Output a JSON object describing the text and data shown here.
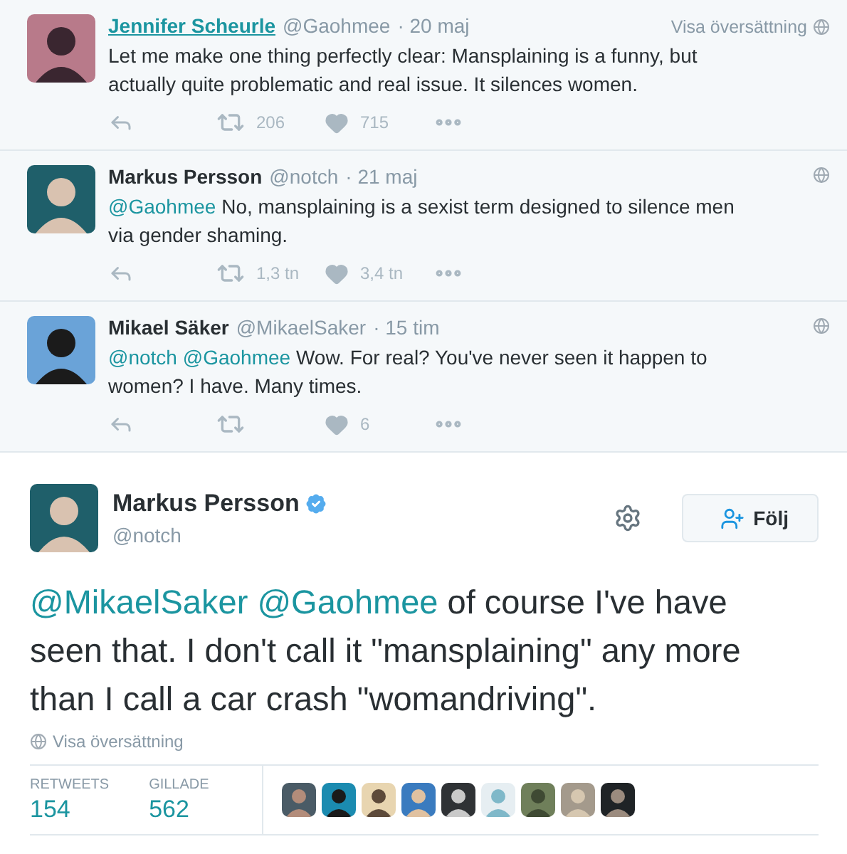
{
  "replies": [
    {
      "name": "Jennifer Scheurle",
      "name_link": true,
      "handle": "@Gaohmee",
      "time": "· 20 maj",
      "translate": "Visa översättning",
      "text": "Let me make one thing perfectly clear: Mansplaining is a funny, but actually quite problematic and real issue. It silences women.",
      "retweets": "206",
      "likes": "715"
    },
    {
      "name": "Markus Persson",
      "name_link": false,
      "handle": "@notch",
      "time": "· 21 maj",
      "mentions": [
        "@Gaohmee"
      ],
      "text": "No, mansplaining is a sexist term designed to silence men via gender shaming.",
      "retweets": "1,3 tn",
      "likes": "3,4 tn"
    },
    {
      "name": "Mikael Säker",
      "name_link": false,
      "handle": "@MikaelSaker",
      "time": "· 15 tim",
      "mentions": [
        "@notch",
        "@Gaohmee"
      ],
      "text": "Wow. For real? You've never seen it happen to women? I have. Many times.",
      "likes": "6"
    }
  ],
  "tweet": {
    "name": "Markus Persson",
    "verified": true,
    "handle": "@notch",
    "follow": "Följ",
    "mentions": [
      "@MikaelSaker",
      "@Gaohmee"
    ],
    "text": "of course I've have seen that. I don't call it \"mansplaining\" any more than I call a car crash \"womandriving\".",
    "translate": "Visa översättning",
    "stats": [
      {
        "label": "RETWEETS",
        "value": "154"
      },
      {
        "label": "GILLADE",
        "value": "562"
      }
    ],
    "likers": [
      {
        "kind": "avatar"
      },
      {
        "kind": "avatar"
      },
      {
        "kind": "avatar"
      },
      {
        "kind": "avatar"
      },
      {
        "kind": "avatar"
      },
      {
        "kind": "avatar"
      },
      {
        "kind": "avatar"
      },
      {
        "kind": "avatar"
      },
      {
        "kind": "avatar"
      }
    ]
  }
}
